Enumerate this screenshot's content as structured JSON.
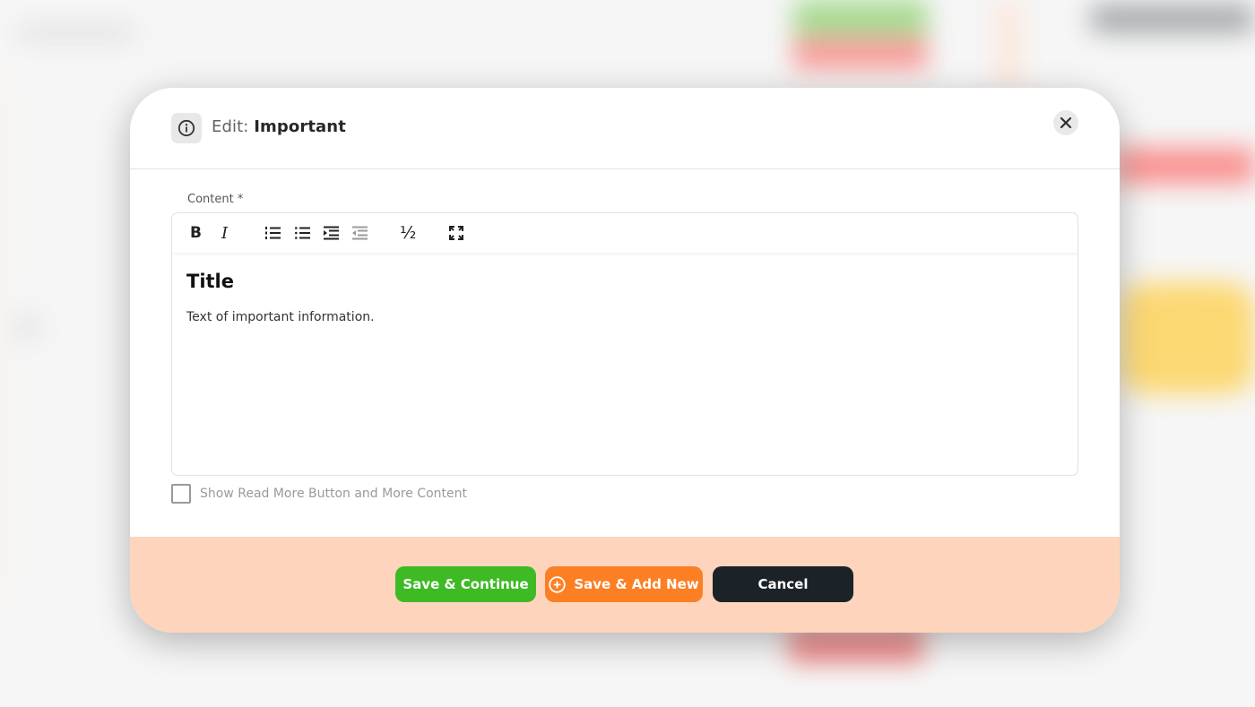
{
  "modal": {
    "title_prefix": "Edit:",
    "title_name": "Important",
    "header_icon": "info-icon",
    "close_icon": "close-icon"
  },
  "form": {
    "content_label": "Content *",
    "toolbar": [
      {
        "name": "bold",
        "label": "B"
      },
      {
        "name": "italic",
        "label": "I"
      },
      {
        "name": "ordered-list",
        "icon": "ordered-list-icon"
      },
      {
        "name": "unordered-list",
        "icon": "unordered-list-icon"
      },
      {
        "name": "indent",
        "icon": "indent-icon"
      },
      {
        "name": "outdent",
        "icon": "outdent-icon"
      },
      {
        "name": "fraction",
        "label": "½"
      },
      {
        "name": "fullscreen",
        "icon": "fullscreen-icon"
      }
    ],
    "editor": {
      "heading": "Title",
      "paragraph": "Text of important information."
    },
    "checkbox": {
      "label": "Show Read More Button and More Content",
      "checked": false
    }
  },
  "footer": {
    "save_continue": "Save & Continue",
    "save_add_new": "Save & Add New",
    "cancel": "Cancel"
  },
  "colors": {
    "save_green": "#3eba24",
    "add_orange": "#fd7f24",
    "cancel_dark": "#1b2228",
    "footer_bg": "#fed5bc"
  }
}
